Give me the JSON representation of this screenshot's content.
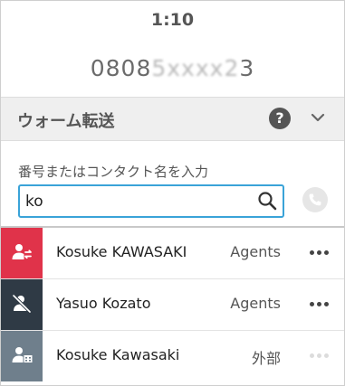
{
  "call": {
    "timer": "1:10",
    "number_visible": "0808",
    "number_masked": "5     ",
    "number_tail": "3"
  },
  "section": {
    "title": "ウォーム転送"
  },
  "search": {
    "prompt": "番号またはコンタクト名を入力",
    "value": "ko",
    "placeholder": ""
  },
  "contacts": [
    {
      "name": "Kosuke KAWASAKI",
      "type": "Agents",
      "avatar_color": "#e0334a",
      "icon": "agent-transfer-icon"
    },
    {
      "name": "Yasuo Kozato",
      "type": "Agents",
      "avatar_color": "#2f3a45",
      "icon": "agent-offline-icon"
    },
    {
      "name": "Kosuke Kawasaki",
      "type": "外部",
      "avatar_color": "#6f7f8c",
      "icon": "external-contact-icon"
    }
  ],
  "colors": {
    "accent": "#3aa3d8",
    "header_bg": "#efefef"
  }
}
